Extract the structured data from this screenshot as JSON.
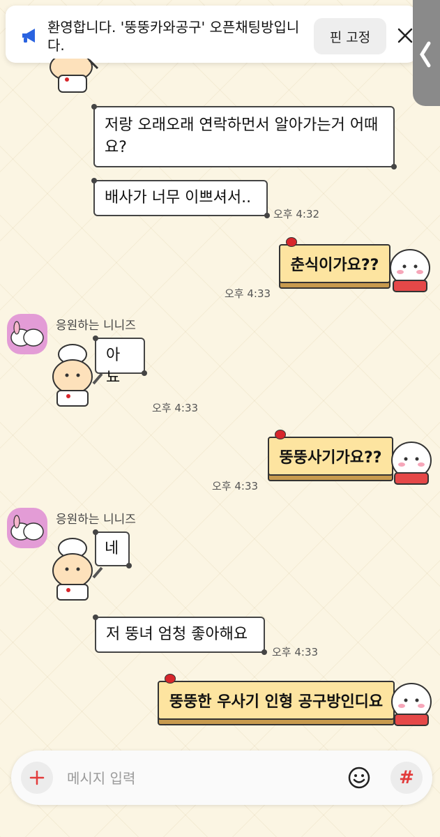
{
  "notice": {
    "text": "환영합니다. '뚱뚱카와공구' 오픈채팅방입니다.",
    "pin_label": "핀 고정",
    "icon": "megaphone-icon"
  },
  "messages": {
    "m1": "저랑 오래오래 연락하먼서 알아가는거 어때요?",
    "m2": "배사가 너무 이쁘셔서..",
    "m2_time": "오후 4:32",
    "m3": "춘식이가요??",
    "m3_time": "오후 4:33",
    "sender1": "응원하는 니니즈",
    "m4": "아뇨",
    "m4_time": "오후 4:33",
    "m5": "뚱뚱사기가요??",
    "m5_time": "오후 4:33",
    "sender2": "응원하는 니니즈",
    "m6": "네",
    "m7": "저 뚱녀 엄청 좋아해요",
    "m7_time": "오후 4:33",
    "m8": "뚱뚱한 우사기 인형 공구방인디요"
  },
  "input": {
    "placeholder": "메시지 입력"
  },
  "colors": {
    "accent": "#e23b3b",
    "cake": "#fde4a0",
    "background": "#fbf5e3",
    "profile": "#e39cd6"
  }
}
